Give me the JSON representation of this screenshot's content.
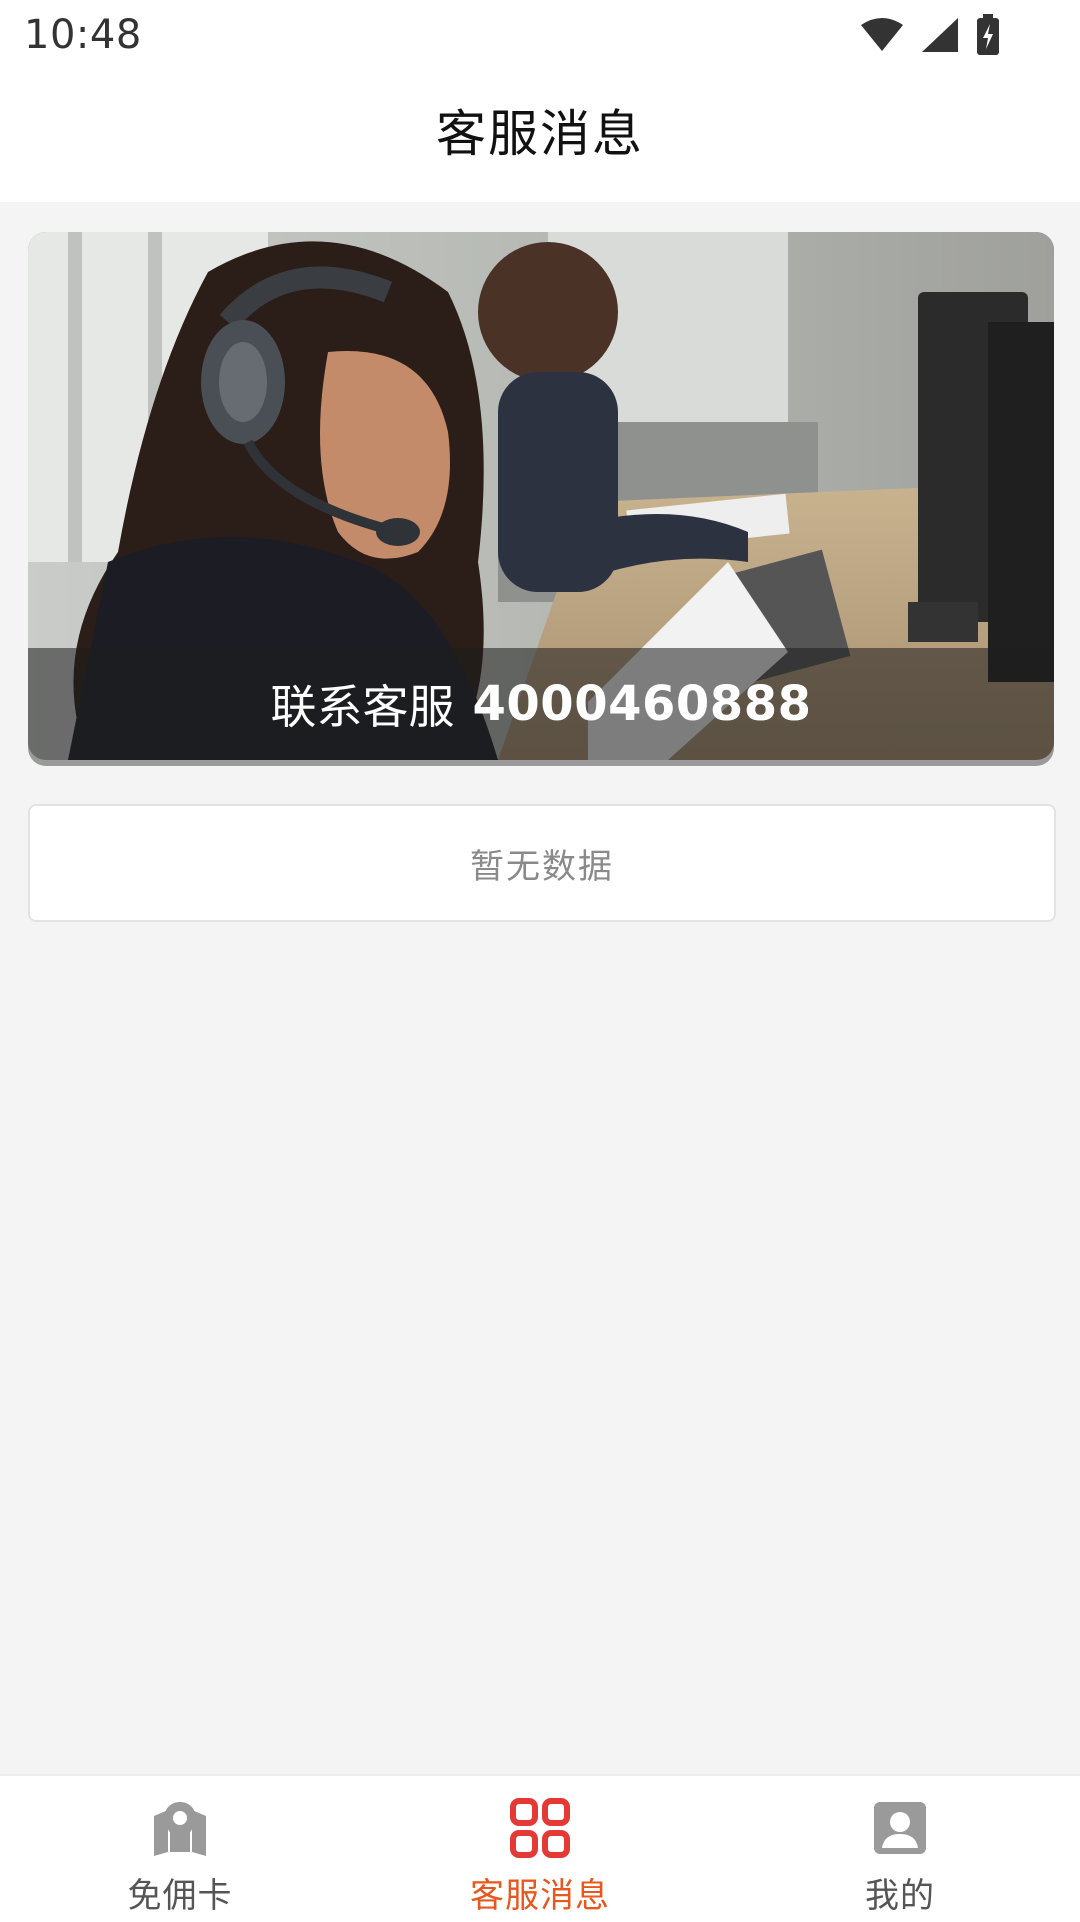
{
  "status_bar": {
    "time": "10:48",
    "icons": [
      "wifi-icon",
      "signal-icon",
      "battery-charging-icon"
    ]
  },
  "header": {
    "title": "客服消息"
  },
  "banner": {
    "caption_label": "联系客服",
    "phone": "4000460888"
  },
  "empty_state": {
    "text": "暂无数据"
  },
  "tab_bar": {
    "items": [
      {
        "label": "免佣卡",
        "icon": "map-pin-icon",
        "active": false
      },
      {
        "label": "客服消息",
        "icon": "grid-icon",
        "active": true
      },
      {
        "label": "我的",
        "icon": "profile-icon",
        "active": false
      }
    ]
  },
  "colors": {
    "accent": "#e8571e",
    "active_icon": "#e53935",
    "inactive": "#9a9a9a",
    "background": "#f4f4f4"
  }
}
